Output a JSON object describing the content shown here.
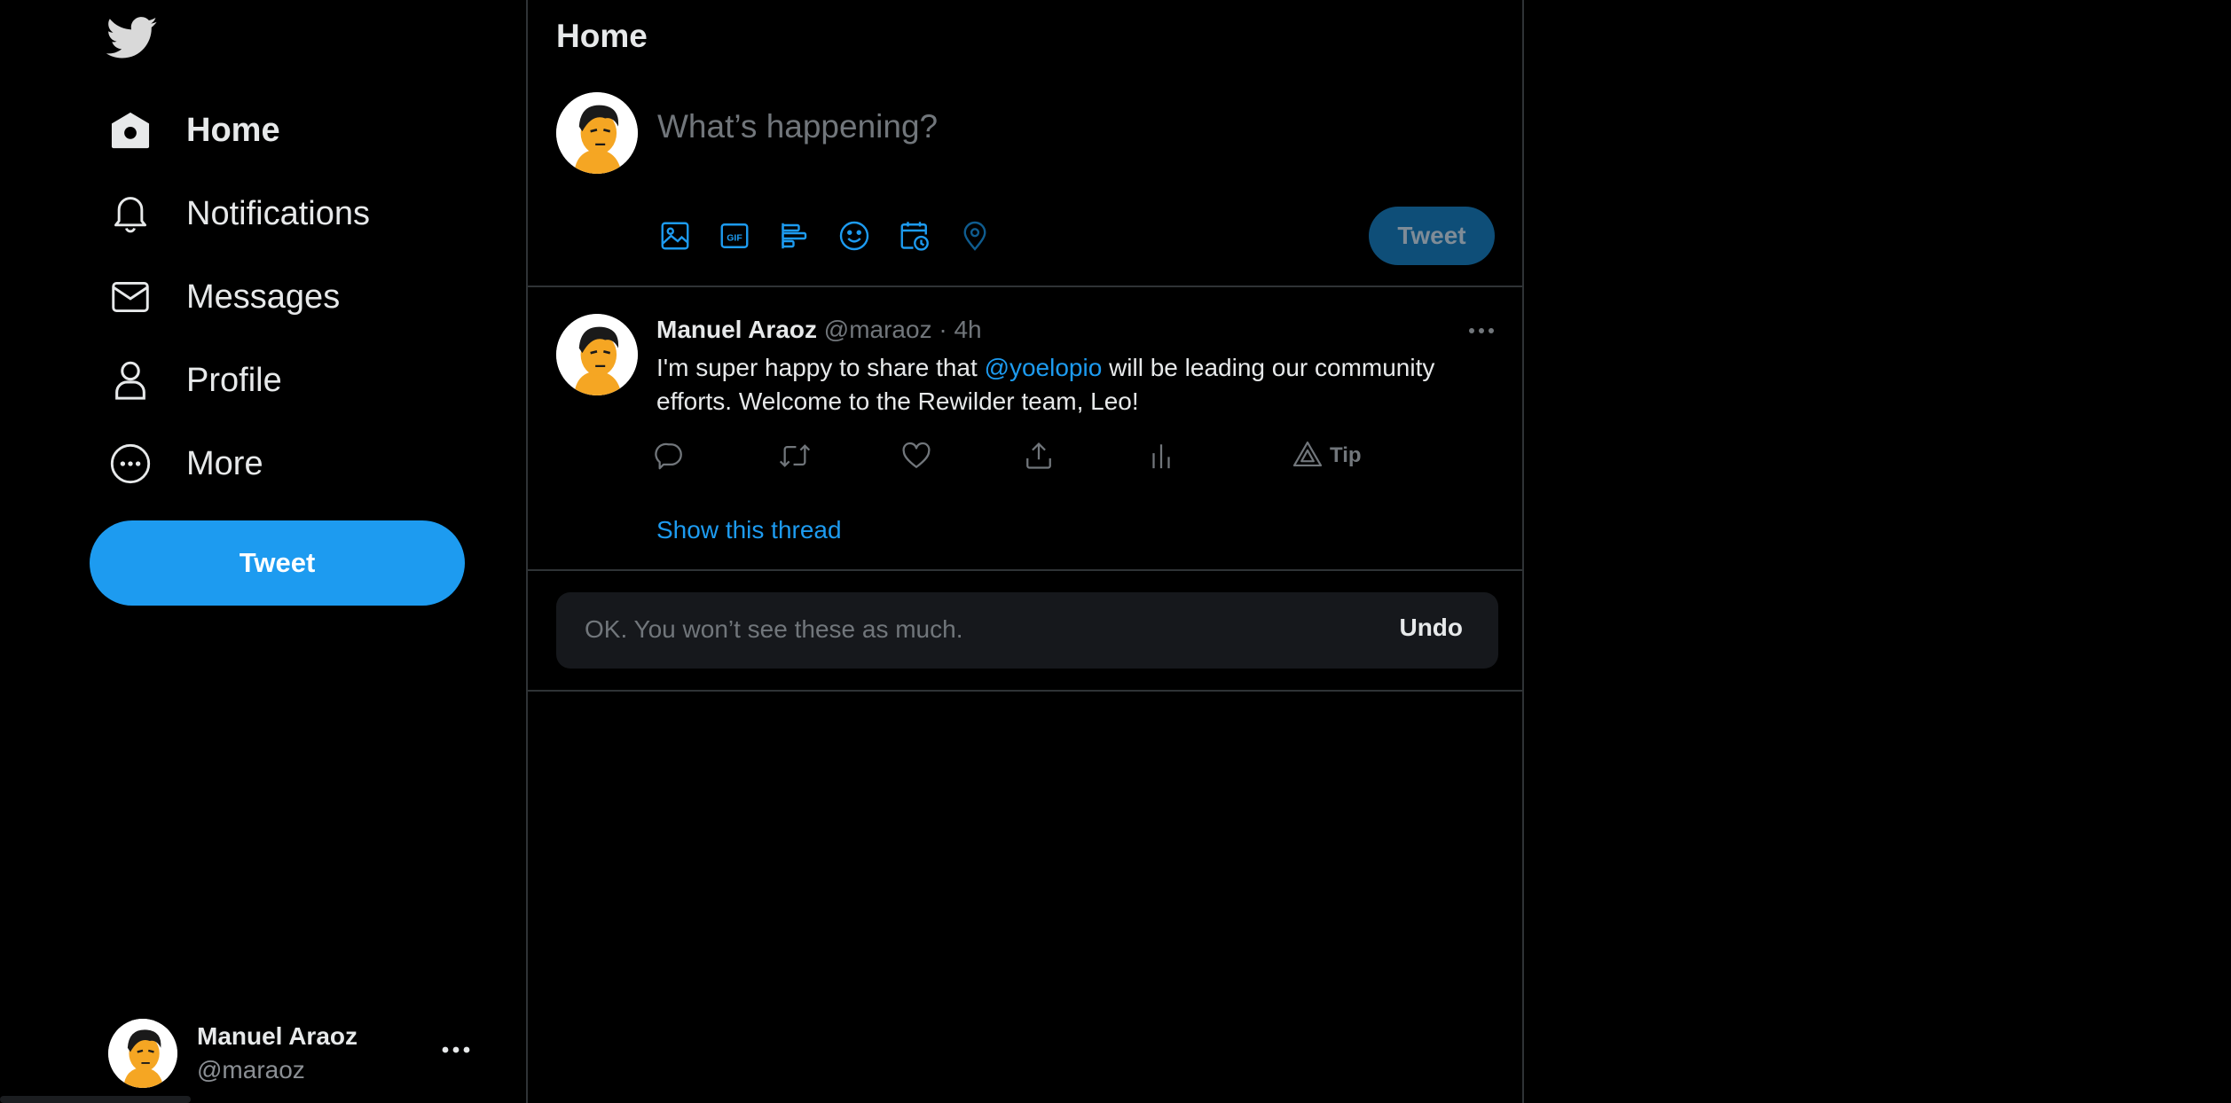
{
  "sidebar": {
    "nav": [
      {
        "label": "Home",
        "icon": "home-icon"
      },
      {
        "label": "Notifications",
        "icon": "bell-icon"
      },
      {
        "label": "Messages",
        "icon": "envelope-icon"
      },
      {
        "label": "Profile",
        "icon": "person-icon"
      },
      {
        "label": "More",
        "icon": "more-circle-icon"
      }
    ],
    "tweet_button": "Tweet",
    "account": {
      "name": "Manuel Araoz",
      "handle": "@maraoz"
    }
  },
  "main": {
    "title": "Home",
    "composer": {
      "placeholder": "What’s happening?",
      "tweet_button": "Tweet",
      "tools": [
        "image-icon",
        "gif-icon",
        "poll-icon",
        "emoji-icon",
        "schedule-icon",
        "location-icon"
      ]
    },
    "tweet": {
      "author": "Manuel Araoz",
      "meta": "@maraoz · 4h",
      "text_before": "I'm super happy to share that ",
      "mention": "@yoelopio",
      "text_after": " will be leading our community efforts. Welcome to the Rewilder team, Leo!",
      "tip_label": "Tip",
      "show_thread": "Show this thread"
    },
    "undo": {
      "message": "OK. You won’t see these as much.",
      "button": "Undo"
    }
  },
  "colors": {
    "accent": "#1d9bf0",
    "background": "#000000",
    "muted": "#71767b",
    "border": "#2f3336"
  }
}
